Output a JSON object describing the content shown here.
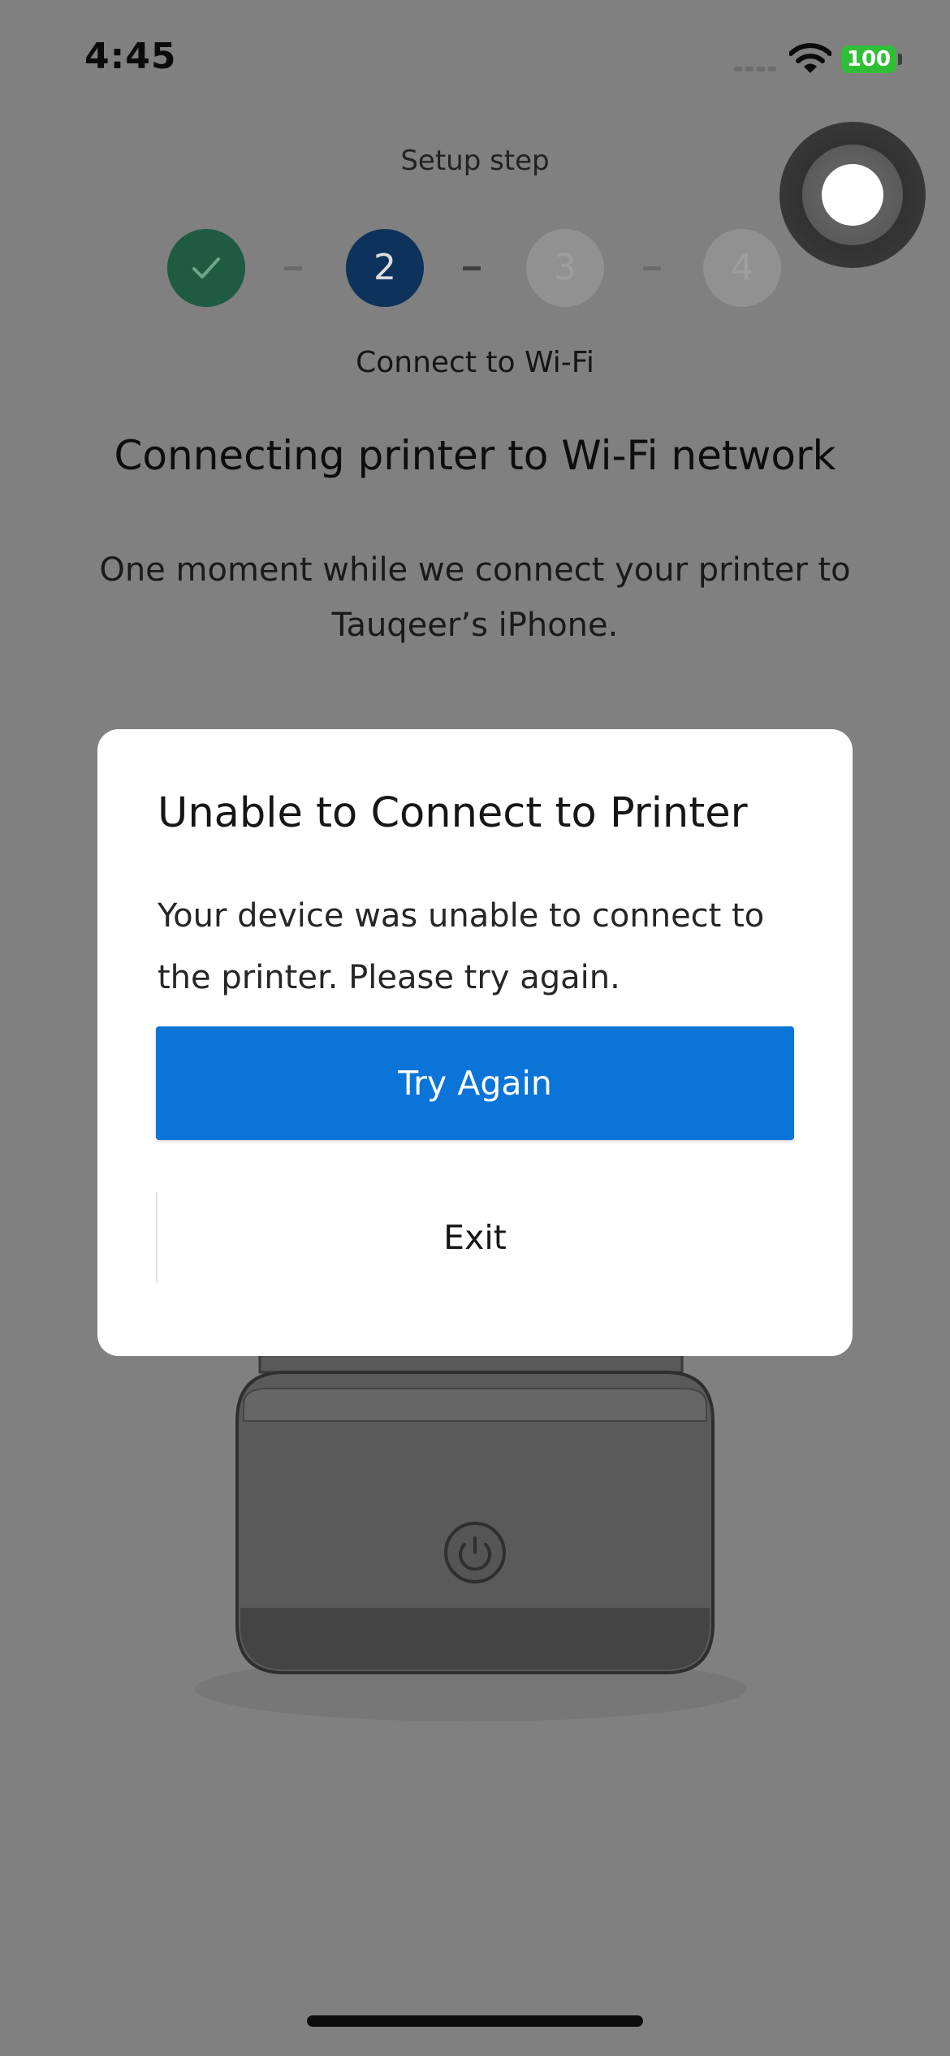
{
  "status_bar": {
    "time": "4:45",
    "battery": "100",
    "signal_icon": "cellular-signal-icon",
    "wifi_icon": "wifi-icon"
  },
  "setup": {
    "caption": "Setup step",
    "steps": [
      {
        "label": "",
        "state": "done",
        "icon": "checkmark-icon"
      },
      {
        "label": "2",
        "state": "current"
      },
      {
        "label": "3",
        "state": "upcoming"
      },
      {
        "label": "4",
        "state": "upcoming"
      }
    ],
    "current_step_label": "Connect to Wi-Fi"
  },
  "main": {
    "heading": "Connecting printer to Wi-Fi network",
    "description": "One moment while we connect your printer to Tauqeer’s iPhone."
  },
  "dialog": {
    "title": "Unable to Connect to Printer",
    "message": "Your device was unable to connect to the printer. Please try again.",
    "primary_button": "Try Again",
    "secondary_button": "Exit"
  },
  "colors": {
    "overlay_bg": "#808080",
    "primary_button": "#0a74d8",
    "step_done": "#1f5a43",
    "step_current": "#0d335c",
    "battery": "#2fbf36"
  }
}
